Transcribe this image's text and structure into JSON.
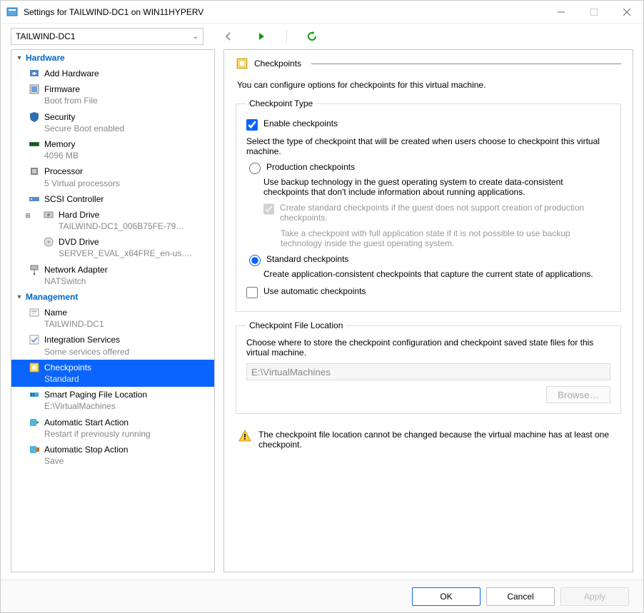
{
  "window": {
    "title": "Settings for TAILWIND-DC1 on WIN11HYPERV"
  },
  "vm_selector": {
    "value": "TAILWIND-DC1"
  },
  "sidebar": {
    "sections": [
      {
        "label": "Hardware"
      },
      {
        "label": "Management"
      }
    ],
    "hardware_items": [
      {
        "label": "Add Hardware",
        "sub": ""
      },
      {
        "label": "Firmware",
        "sub": "Boot from File"
      },
      {
        "label": "Security",
        "sub": "Secure Boot enabled"
      },
      {
        "label": "Memory",
        "sub": "4096 MB"
      },
      {
        "label": "Processor",
        "sub": "5 Virtual processors"
      },
      {
        "label": "SCSI Controller",
        "sub": ""
      },
      {
        "label": "Hard Drive",
        "sub": "TAILWIND-DC1_006B75FE-79…"
      },
      {
        "label": "DVD Drive",
        "sub": "SERVER_EVAL_x64FRE_en-us.…"
      },
      {
        "label": "Network Adapter",
        "sub": "NATSwitch"
      }
    ],
    "management_items": [
      {
        "label": "Name",
        "sub": "TAILWIND-DC1"
      },
      {
        "label": "Integration Services",
        "sub": "Some services offered"
      },
      {
        "label": "Checkpoints",
        "sub": "Standard"
      },
      {
        "label": "Smart Paging File Location",
        "sub": "E:\\VirtualMachines"
      },
      {
        "label": "Automatic Start Action",
        "sub": "Restart if previously running"
      },
      {
        "label": "Automatic Stop Action",
        "sub": "Save"
      }
    ]
  },
  "rightpanel": {
    "heading": "Checkpoints",
    "intro": "You can configure options for checkpoints for this virtual machine.",
    "group_type_legend": "Checkpoint Type",
    "enable_label": "Enable checkpoints",
    "type_desc": "Select the type of checkpoint that will be created when users choose to checkpoint this virtual machine.",
    "prod_label": "Production checkpoints",
    "prod_desc": "Use backup technology in the guest operating system to create data-consistent checkpoints that don't include information about running applications.",
    "prod_fallback_label": "Create standard checkpoints if the guest does not support creation of production checkpoints.",
    "prod_fallback_note": "Take a checkpoint with full application state if it is not possible to use backup technology inside the guest operating system.",
    "std_label": "Standard checkpoints",
    "std_desc": "Create application-consistent checkpoints that capture the current state of applications.",
    "auto_label": "Use automatic checkpoints",
    "group_loc_legend": "Checkpoint File Location",
    "loc_desc": "Choose where to store the checkpoint configuration and checkpoint saved state files for this virtual machine.",
    "loc_value": "E:\\VirtualMachines",
    "browse_label": "Browse…",
    "warning": "The checkpoint file location cannot be changed because the virtual machine has at least one checkpoint."
  },
  "buttons": {
    "ok": "OK",
    "cancel": "Cancel",
    "apply": "Apply"
  }
}
